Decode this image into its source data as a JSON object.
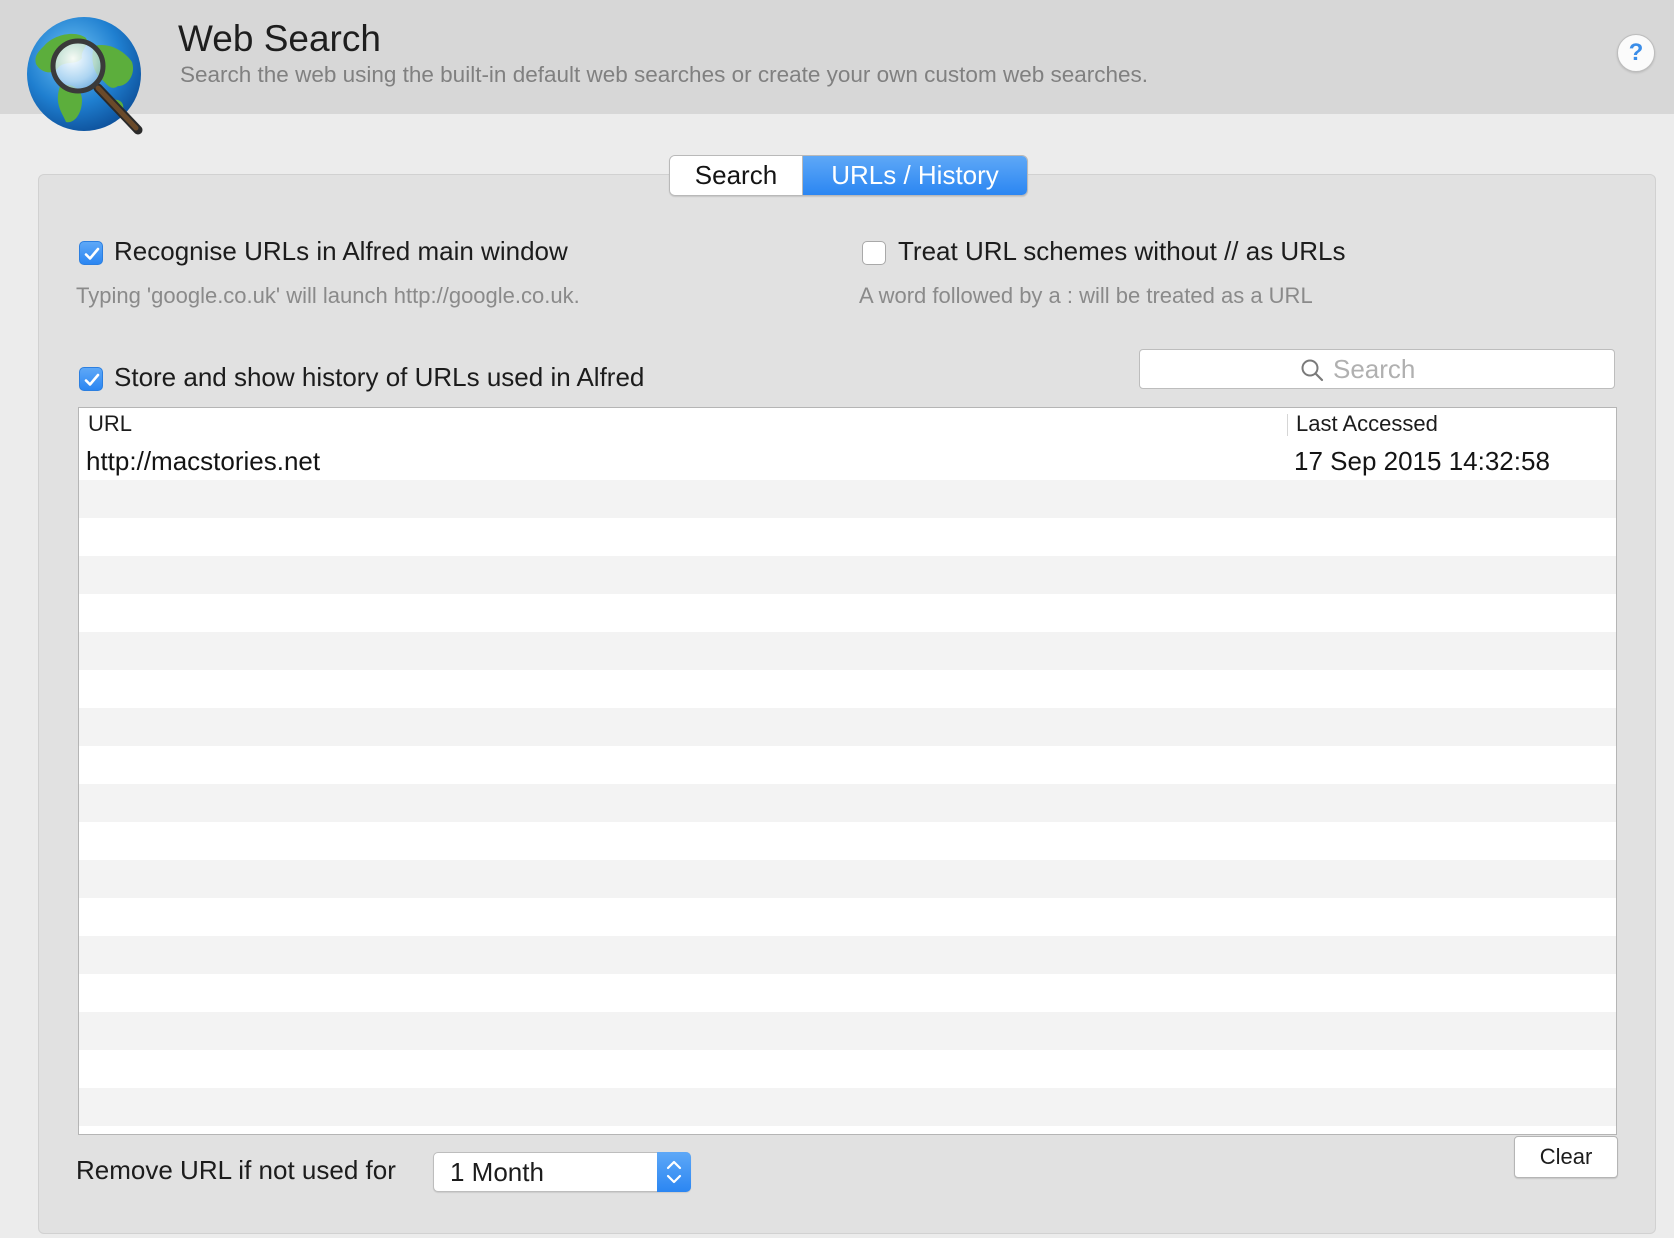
{
  "header": {
    "title": "Web Search",
    "subtitle": "Search the web using the built-in default web searches or create your own custom web searches.",
    "logo_icon": "globe-magnifier-icon",
    "help_label": "?"
  },
  "tabs": [
    {
      "label": "Search",
      "selected": false
    },
    {
      "label": "URLs / History",
      "selected": true
    }
  ],
  "options": {
    "recognise_urls": {
      "label": "Recognise URLs in Alfred main window",
      "hint": "Typing 'google.co.uk' will launch http://google.co.uk.",
      "checked": true
    },
    "treat_schemes": {
      "label": "Treat URL schemes without // as URLs",
      "hint": "A word followed by a : will be treated as a URL",
      "checked": false
    },
    "store_history": {
      "label": "Store and show history of URLs used in Alfred",
      "checked": true
    }
  },
  "search": {
    "placeholder": "Search",
    "value": ""
  },
  "history_table": {
    "columns": [
      "URL",
      "Last Accessed"
    ],
    "rows": [
      {
        "url": "http://macstories.net",
        "last_accessed": "17 Sep 2015 14:32:58"
      }
    ]
  },
  "footer": {
    "remove_label": "Remove URL if not used for",
    "remove_period": "1 Month",
    "clear_label": "Clear"
  },
  "colors": {
    "accent": "#2b86f2",
    "header_bg": "#d7d7d7",
    "panel_bg": "#e1e1e1"
  }
}
